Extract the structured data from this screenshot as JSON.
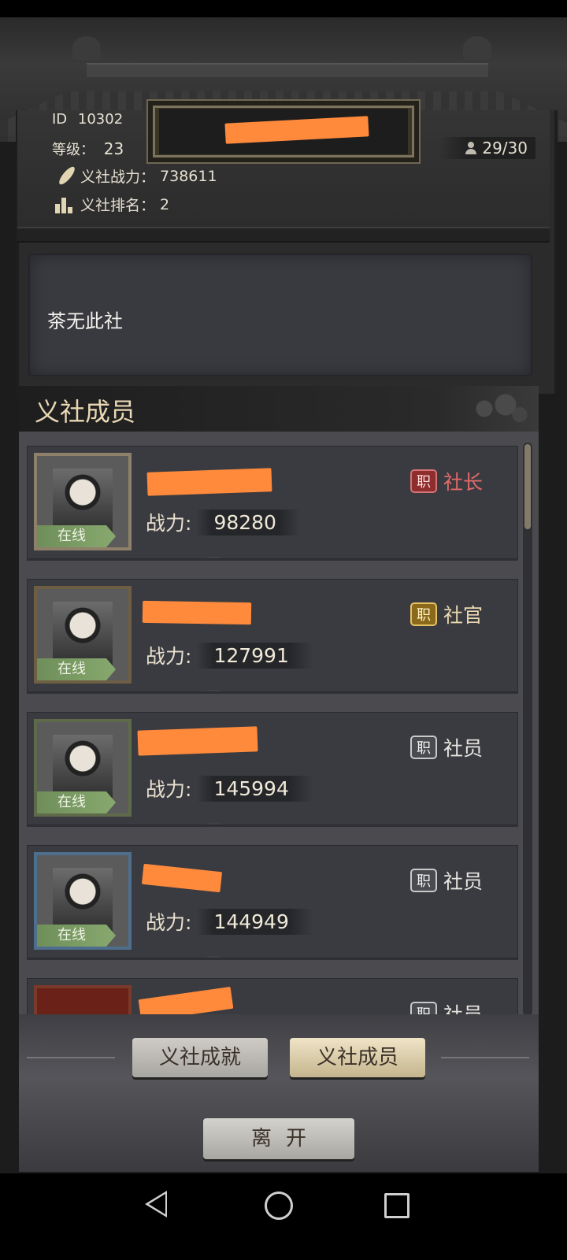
{
  "guild": {
    "id_label": "ID",
    "id_value": "10302",
    "level_label": "等级：",
    "level_value": "23",
    "member_count": "29/30",
    "power_label": "义社战力：",
    "power_value": "738611",
    "rank_label": "义社排名：",
    "rank_value": "2",
    "announcement": "茶无此社"
  },
  "members_section": {
    "title": "义社成员",
    "power_label": "战力:",
    "role_icon_text": "职",
    "members": [
      {
        "power": "98280",
        "role": "社长",
        "status": "在线",
        "role_type": "leader"
      },
      {
        "power": "127991",
        "role": "社官",
        "status": "在线",
        "role_type": "officer"
      },
      {
        "power": "145994",
        "role": "社员",
        "status": "在线",
        "role_type": "member"
      },
      {
        "power": "144949",
        "role": "社员",
        "status": "在线",
        "role_type": "member"
      },
      {
        "power": "",
        "role": "社员",
        "status": "",
        "role_type": "member"
      }
    ]
  },
  "tabs": {
    "achievements": "义社成就",
    "members": "义社成员"
  },
  "leave_button": "离开",
  "icons": {
    "member_count": "person-icon",
    "power": "feather-icon",
    "rank": "bars-icon",
    "nav_back": "back-triangle-icon",
    "nav_home": "home-circle-icon",
    "nav_recent": "recent-square-icon"
  },
  "colors": {
    "leader_role": "#e06a6a",
    "officer_badge": "#e7c265",
    "online_tag": "#87a96e",
    "redaction": "#ff8a3c"
  }
}
